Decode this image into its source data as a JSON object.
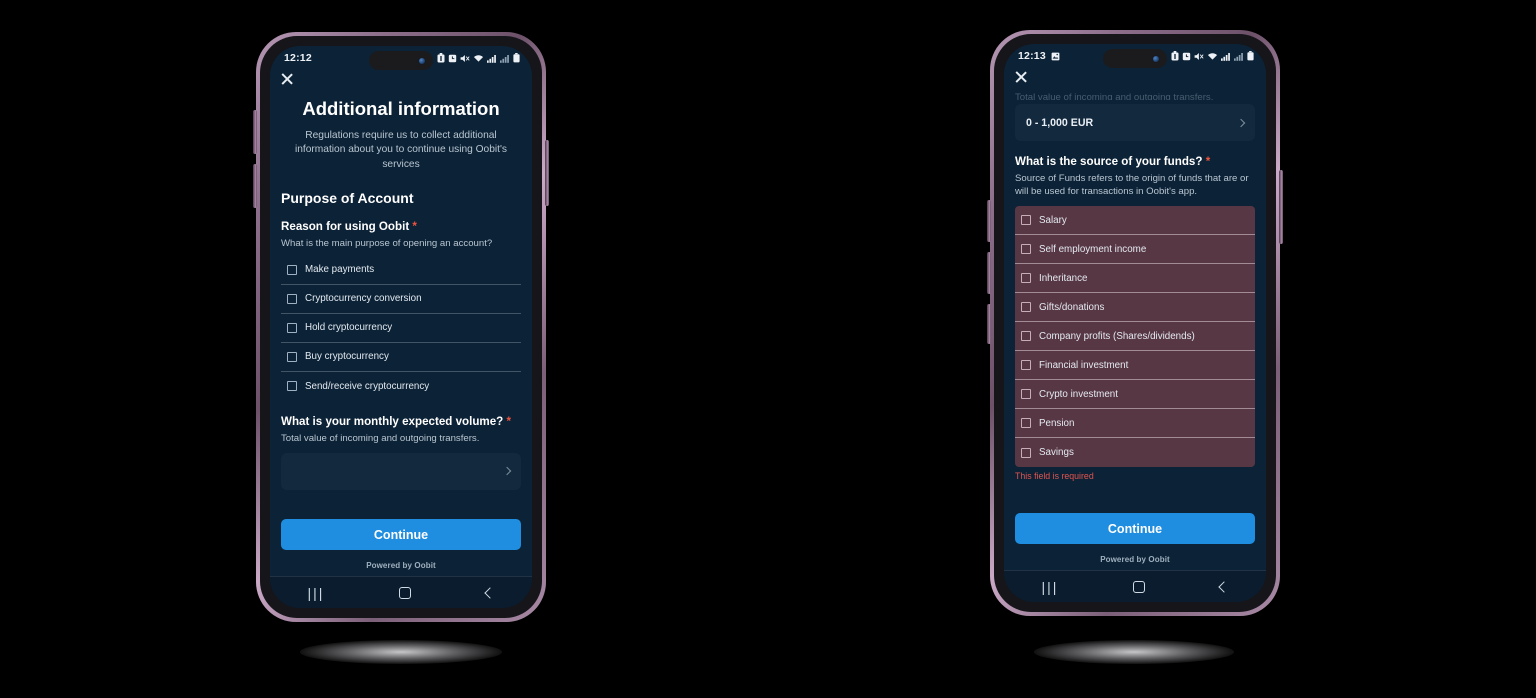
{
  "scene": {
    "background_color": "#000000",
    "phone_frame_color": "#a98aa6",
    "screen_background": "#0c2236",
    "accent_color": "#1f8de0",
    "required_color": "#f0543f",
    "error_block_color": "#583744",
    "error_text_color": "#e2544f"
  },
  "phone_left": {
    "status_bar": {
      "time": "12:12",
      "left_icons": [],
      "right_icons": [
        "battery-saver-icon",
        "alarm-icon",
        "mute-icon",
        "wifi-icon",
        "signal-icon",
        "signal-2-icon",
        "battery-icon"
      ]
    },
    "close_label": "Close",
    "title": "Additional information",
    "subtitle": "Regulations require us to collect additional information about you to continue using Oobit's services",
    "section_heading": "Purpose of Account",
    "question_1": {
      "label": "Reason for using Oobit",
      "required_mark": "*",
      "help": "What is the main purpose of opening an account?",
      "options": [
        "Make payments",
        "Cryptocurrency conversion",
        "Hold cryptocurrency",
        "Buy cryptocurrency",
        "Send/receive cryptocurrency"
      ]
    },
    "question_2": {
      "label": "What is your monthly expected volume?",
      "required_mark": "*",
      "help": "Total value of incoming and outgoing transfers.",
      "select_value": ""
    },
    "continue_label": "Continue",
    "powered_by": "Powered by Oobit",
    "nav_bar": [
      "recents-icon",
      "home-icon",
      "back-icon"
    ]
  },
  "phone_right": {
    "status_bar": {
      "time": "12:13",
      "left_icons": [
        "screenshot-icon"
      ],
      "right_icons": [
        "battery-saver-icon",
        "alarm-icon",
        "mute-icon",
        "wifi-icon",
        "signal-icon",
        "signal-2-icon",
        "battery-icon"
      ]
    },
    "close_label": "Close",
    "clipped_help": "Total value of incoming and outgoing transfers.",
    "volume_select_value": "0 - 1,000 EUR",
    "question": {
      "label": "What is the source of your funds?",
      "required_mark": "*",
      "help": "Source of Funds refers to the origin of funds that are or will be used for transactions in Oobit's app.",
      "options": [
        "Salary",
        "Self employment income",
        "Inheritance",
        "Gifts/donations",
        "Company profits (Shares/dividends)",
        "Financial investment",
        "Crypto investment",
        "Pension",
        "Savings"
      ],
      "error_message": "This field is required"
    },
    "continue_label": "Continue",
    "powered_by": "Powered by Oobit",
    "nav_bar": [
      "recents-icon",
      "home-icon",
      "back-icon"
    ]
  }
}
